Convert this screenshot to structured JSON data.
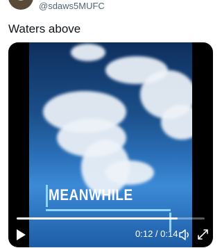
{
  "tweet": {
    "handle": "@sdaws5MUFC",
    "text": "Waters above"
  },
  "video": {
    "overlay_text": "MEANWHILE",
    "time_readout": "0:12 / 0:14",
    "progress": 0.857
  },
  "icons": {
    "play": "play-icon",
    "volume": "speaker-icon",
    "fullscreen": "expand-icon"
  }
}
